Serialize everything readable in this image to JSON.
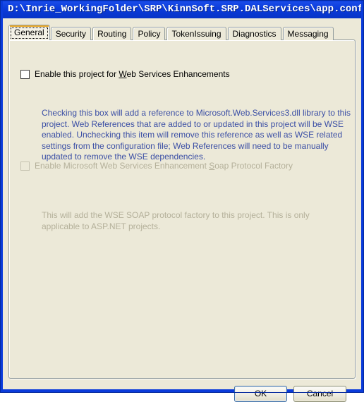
{
  "window": {
    "title": "D:\\Inrie_WorkingFolder\\SRP\\KinnSoft.SRP.DALServices\\app.config",
    "titlebar_color": "#0a3bdb",
    "background_color": "#ece9d8"
  },
  "tabs": [
    {
      "label": "General",
      "active": true
    },
    {
      "label": "Security",
      "active": false
    },
    {
      "label": "Routing",
      "active": false
    },
    {
      "label": "Policy",
      "active": false
    },
    {
      "label": "TokenIssuing",
      "active": false
    },
    {
      "label": "Diagnostics",
      "active": false
    },
    {
      "label": "Messaging",
      "active": false
    }
  ],
  "general_tab": {
    "enable_wse": {
      "label_before_accel": "Enable this project for ",
      "accel": "W",
      "label_after_accel": "eb Services Enhancements",
      "checked": false,
      "enabled": true
    },
    "enable_wse_description": "Checking this box will add a reference to Microsoft.Web.Services3.dll library to this project. Web References that are added to or updated in this project will be WSE enabled. Unchecking this item will remove this reference as well as WSE related settings from the configuration file; Web References will need to be manually updated to remove the WSE dependencies.",
    "enable_wse_description_color": "#3b4fa5",
    "enable_soap_factory": {
      "label_before_accel": "Enable Microsoft Web Services Enhancement ",
      "accel": "S",
      "label_after_accel": "oap Protocol Factory",
      "checked": false,
      "enabled": false
    },
    "enable_soap_factory_description": "This will add the WSE SOAP protocol factory to this project. This is only applicable to ASP.NET projects.",
    "enable_soap_factory_description_color": "#b4b09a"
  },
  "buttons": {
    "ok": "OK",
    "cancel": "Cancel",
    "default_button": "OK"
  }
}
